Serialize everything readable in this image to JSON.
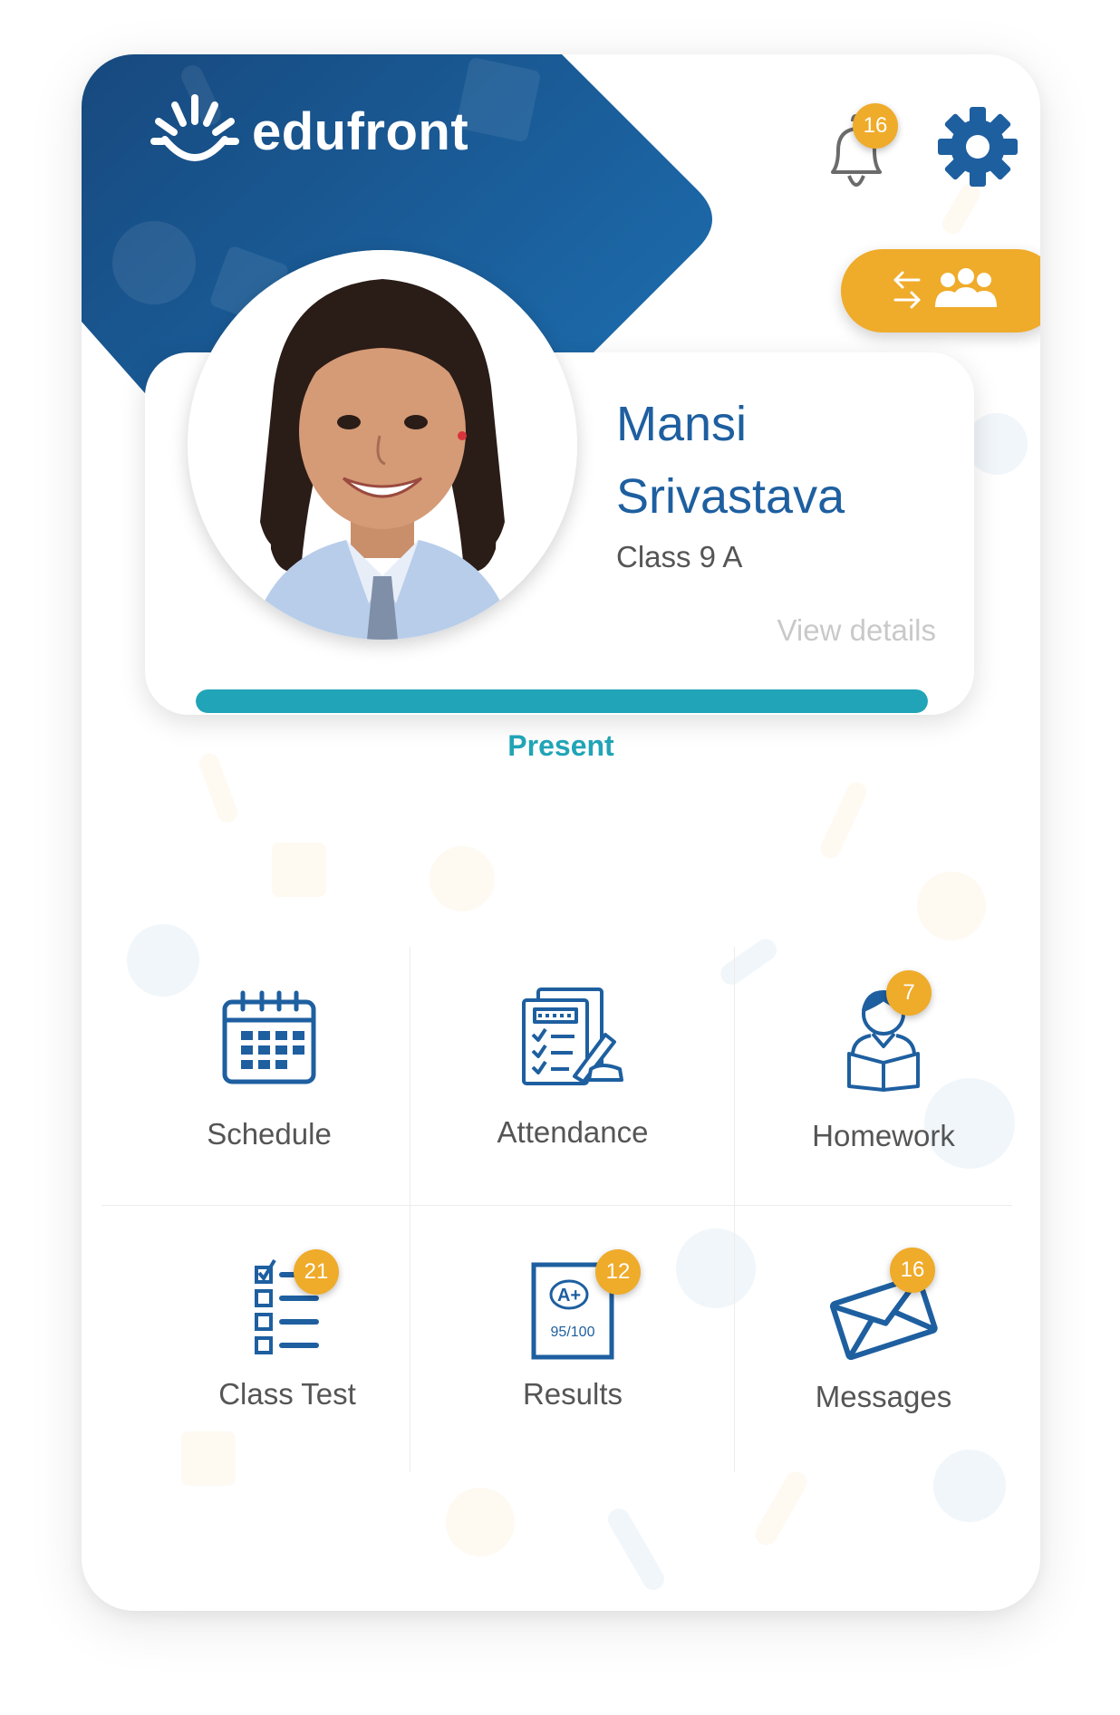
{
  "app": {
    "logo_text": "edufront",
    "brand_color": "#1e5fa0",
    "accent_color": "#efab2a",
    "status_color": "#21a4b7"
  },
  "header": {
    "notifications_icon": "bell-icon",
    "notifications_count": "16",
    "settings_icon": "gear-icon",
    "switch_profile_icon": "switch-user-icon"
  },
  "profile": {
    "first_name": "Mansi",
    "last_name": "Srivastava",
    "class": "Class 9 A",
    "view_details": "View details",
    "attendance_status": "Present",
    "attendance_fraction": 1.0
  },
  "menu": [
    {
      "label": "Schedule",
      "icon": "calendar-icon",
      "badge": ""
    },
    {
      "label": "Attendance",
      "icon": "attendance-sheet-icon",
      "badge": ""
    },
    {
      "label": "Homework",
      "icon": "student-reading-icon",
      "badge": "7"
    },
    {
      "label": "Class Test",
      "icon": "checklist-icon",
      "badge": "21"
    },
    {
      "label": "Results",
      "icon": "report-card-icon",
      "badge": "12",
      "icon_grade": "A+",
      "icon_score": "95/100"
    },
    {
      "label": "Messages",
      "icon": "envelope-icon",
      "badge": "16"
    }
  ]
}
